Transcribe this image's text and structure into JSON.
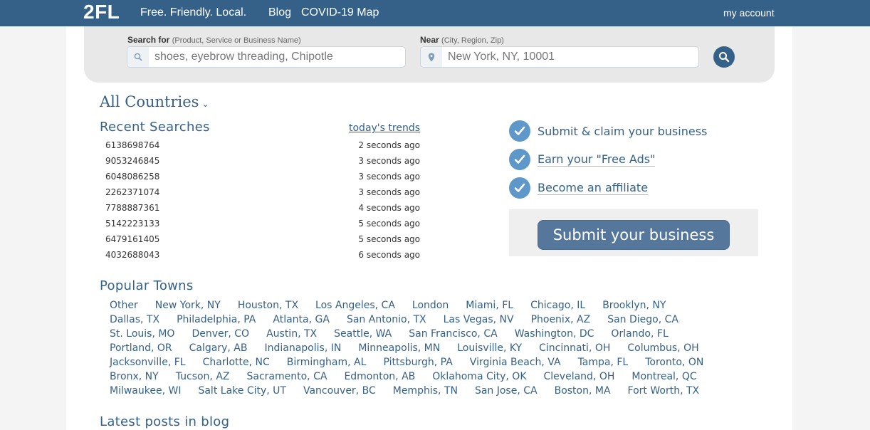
{
  "header": {
    "logo": "2FL",
    "tagline": "Free. Friendly. Local.",
    "nav_blog": "Blog",
    "nav_covid": "COVID-19 Map",
    "account": "my account"
  },
  "search": {
    "what_label": "Search for",
    "what_hint": "(Product, Service or Business Name)",
    "what_placeholder": "shoes, eyebrow threading, Chipotle",
    "where_label": "Near",
    "where_hint": "(City, Region, Zip)",
    "where_placeholder": "New York, NY, 10001"
  },
  "countries": "All Countries",
  "recent": {
    "title": "Recent Searches",
    "trends": "today's trends",
    "rows": [
      {
        "num": "6138698764",
        "ago": "2 seconds ago"
      },
      {
        "num": "9053246845",
        "ago": "3 seconds ago"
      },
      {
        "num": "6048086258",
        "ago": "3 seconds ago"
      },
      {
        "num": "2262371074",
        "ago": "3 seconds ago"
      },
      {
        "num": "7788887361",
        "ago": "4 seconds ago"
      },
      {
        "num": "5142223133",
        "ago": "5 seconds ago"
      },
      {
        "num": "6479161405",
        "ago": "5 seconds ago"
      },
      {
        "num": "4032688043",
        "ago": "6 seconds ago"
      }
    ]
  },
  "perks": {
    "submit_claim": "Submit & claim your business",
    "free_ads": "Earn your \"Free Ads\"",
    "affiliate": "Become an affiliate",
    "submit_button": "Submit your business"
  },
  "towns": {
    "title": "Popular Towns",
    "rows": [
      [
        "Other",
        "New York, NY",
        "Houston, TX",
        "Los Angeles, CA",
        "London",
        "Miami, FL",
        "Chicago, IL",
        "Brooklyn, NY"
      ],
      [
        "Dallas, TX",
        "Philadelphia, PA",
        "Atlanta, GA",
        "San Antonio, TX",
        "Las Vegas, NV",
        "Phoenix, AZ",
        "San Diego, CA"
      ],
      [
        "St. Louis, MO",
        "Denver, CO",
        "Austin, TX",
        "Seattle, WA",
        "San Francisco, CA",
        "Washington, DC",
        "Orlando, FL"
      ],
      [
        "Portland, OR",
        "Calgary, AB",
        "Indianapolis, IN",
        "Minneapolis, MN",
        "Louisville, KY",
        "Cincinnati, OH",
        "Columbus, OH"
      ],
      [
        "Jacksonville, FL",
        "Charlotte, NC",
        "Birmingham, AL",
        "Pittsburgh, PA",
        "Virginia Beach, VA",
        "Tampa, FL",
        "Toronto, ON"
      ],
      [
        "Bronx, NY",
        "Tucson, AZ",
        "Sacramento, CA",
        "Edmonton, AB",
        "Oklahoma City, OK",
        "Cleveland, OH",
        "Montreal, QC"
      ],
      [
        "Milwaukee, WI",
        "Salt Lake City, UT",
        "Vancouver, BC",
        "Memphis, TN",
        "San Jose, CA",
        "Boston, MA",
        "Fort Worth, TX"
      ]
    ]
  },
  "blog": {
    "title": "Latest posts in blog"
  },
  "colors": {
    "header": "#356189",
    "link": "#356189",
    "check": "#5e97c9",
    "button": "#56779c"
  }
}
